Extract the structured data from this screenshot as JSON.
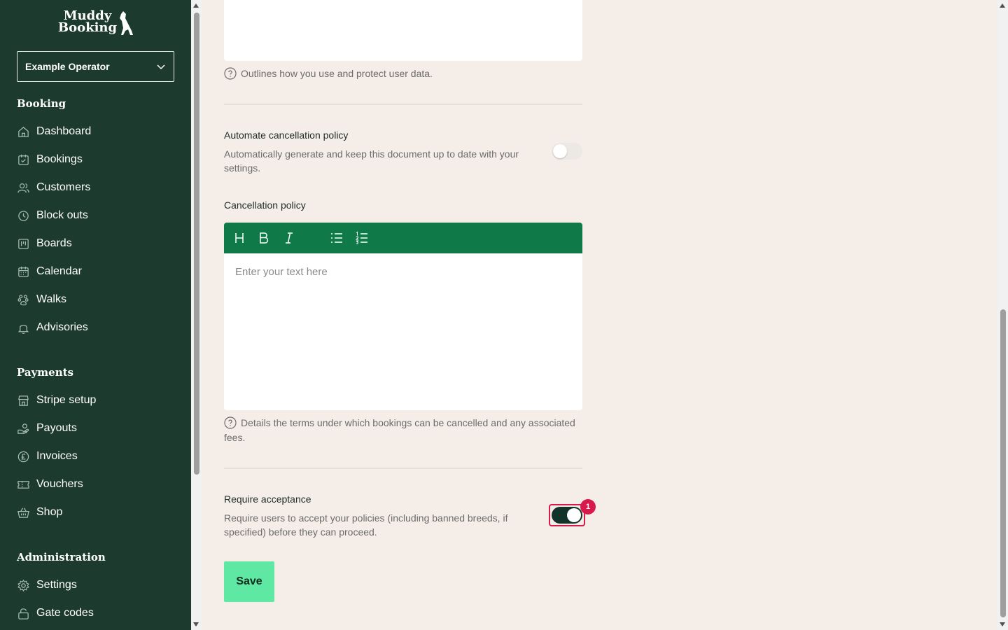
{
  "brand": {
    "logo_text": "Muddy Booking"
  },
  "operator_select": {
    "value": "Example Operator"
  },
  "sidebar": {
    "sections": [
      {
        "title": "Booking",
        "items": [
          {
            "label": "Dashboard",
            "icon": "home-icon"
          },
          {
            "label": "Bookings",
            "icon": "calendar-check-icon"
          },
          {
            "label": "Customers",
            "icon": "users-icon"
          },
          {
            "label": "Block outs",
            "icon": "clock-icon"
          },
          {
            "label": "Boards",
            "icon": "board-icon"
          },
          {
            "label": "Calendar",
            "icon": "calendar-icon"
          },
          {
            "label": "Walks",
            "icon": "paw-icon"
          },
          {
            "label": "Advisories",
            "icon": "bell-icon"
          }
        ]
      },
      {
        "title": "Payments",
        "items": [
          {
            "label": "Stripe setup",
            "icon": "store-icon"
          },
          {
            "label": "Payouts",
            "icon": "payout-icon"
          },
          {
            "label": "Invoices",
            "icon": "pound-icon"
          },
          {
            "label": "Vouchers",
            "icon": "ticket-icon"
          },
          {
            "label": "Shop",
            "icon": "basket-icon"
          }
        ]
      },
      {
        "title": "Administration",
        "items": [
          {
            "label": "Settings",
            "icon": "gear-icon"
          },
          {
            "label": "Gate codes",
            "icon": "lock-icon"
          }
        ]
      }
    ]
  },
  "privacy": {
    "help": "Outlines how you use and protect user data."
  },
  "automate_cancellation": {
    "title": "Automate cancellation policy",
    "description": "Automatically generate and keep this document up to date with your settings.",
    "enabled": false
  },
  "cancellation_policy": {
    "title": "Cancellation policy",
    "placeholder": "Enter your text here",
    "help": "Details the terms under which bookings can be cancelled and any associated fees."
  },
  "require_acceptance": {
    "title": "Require acceptance",
    "description": "Require users to accept your policies (including banned breeds, if specified) before they can proceed.",
    "enabled": true,
    "badge": "1"
  },
  "save_label": "Save",
  "colors": {
    "sidebar": "#1c3a2e",
    "toolbar": "#0f7a48",
    "save": "#5ee8a3",
    "badge": "#d7194b",
    "page": "#f5eee8"
  }
}
